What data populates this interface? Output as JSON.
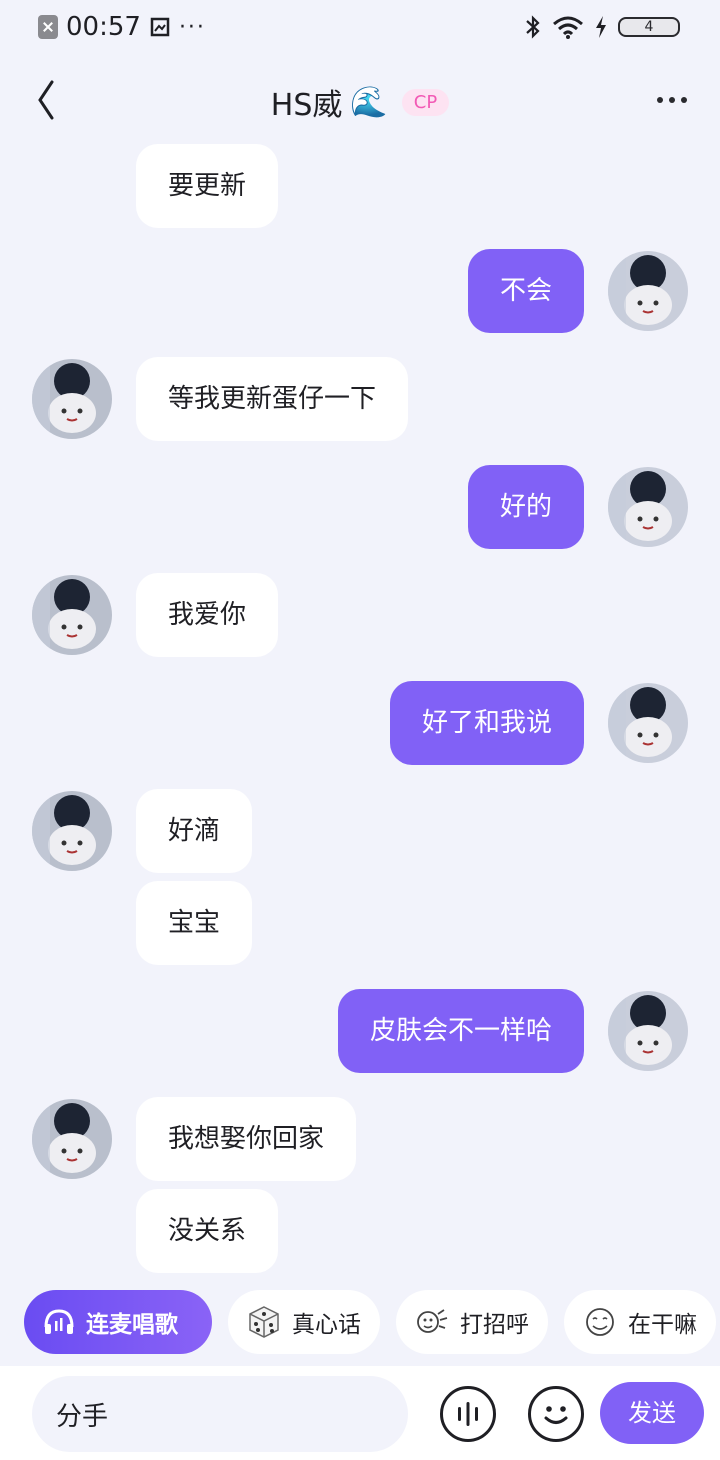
{
  "status_bar": {
    "time": "00:57",
    "dots": "···",
    "battery_level": "4"
  },
  "header": {
    "title": "HS威",
    "title_emoji": "🌊",
    "badge": "CP"
  },
  "messages": [
    {
      "side": "in",
      "text": "要更新",
      "avatar": false
    },
    {
      "side": "out",
      "text": "不会",
      "avatar": true
    },
    {
      "side": "in",
      "text": "等我更新蛋仔一下",
      "avatar": true
    },
    {
      "side": "out",
      "text": "好的",
      "avatar": true
    },
    {
      "side": "in",
      "text": "我爱你",
      "avatar": true
    },
    {
      "side": "out",
      "text": "好了和我说",
      "avatar": true
    },
    {
      "side": "in",
      "text": "好滴",
      "avatar": true
    },
    {
      "side": "in",
      "text": "宝宝",
      "avatar": false
    },
    {
      "side": "out",
      "text": "皮肤会不一样哈",
      "avatar": true
    },
    {
      "side": "in",
      "text": "我想娶你回家",
      "avatar": true
    },
    {
      "side": "in",
      "text": "没关系",
      "avatar": false
    }
  ],
  "chips": [
    {
      "label": "连麦唱歌",
      "icon": "headphones-icon"
    },
    {
      "label": "真心话",
      "icon": "dice-icon"
    },
    {
      "label": "打招呼",
      "icon": "wave-hand-icon"
    },
    {
      "label": "在干嘛",
      "icon": "emoji-face-icon"
    }
  ],
  "input": {
    "value": "分手",
    "send_label": "发送"
  },
  "colors": {
    "accent": "#8161f6",
    "background": "#f2f3fb",
    "badge_text": "#f25ab5",
    "badge_bg": "#fde3f2"
  }
}
